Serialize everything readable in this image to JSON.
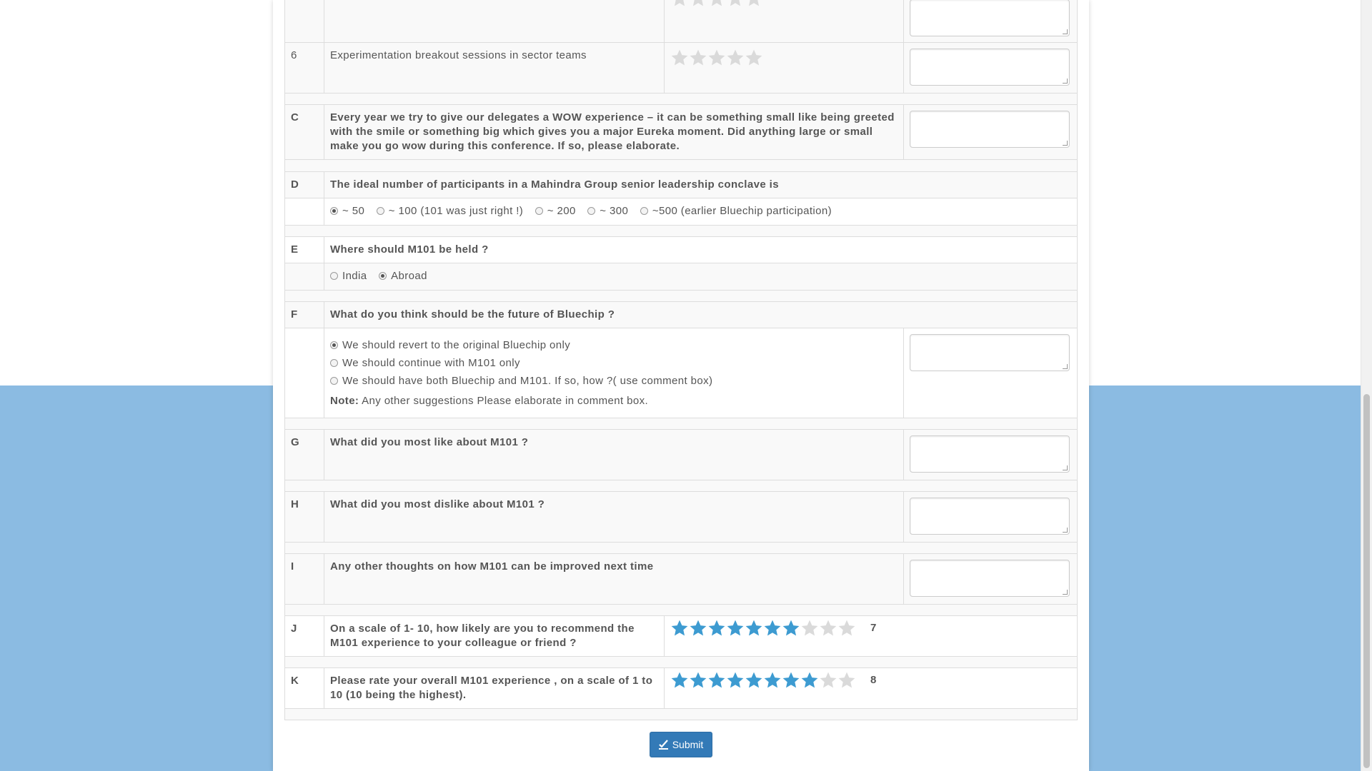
{
  "rows": {
    "r5": {
      "index": "",
      "text": ""
    },
    "r6": {
      "index": "6",
      "text": "Experimentation breakout sessions in sector teams"
    },
    "c": {
      "index": "C",
      "text": "Every year we try to give our delegates a WOW experience – it can be something small like being greeted with the smile or something big which gives you a major Eureka moment. Did anything large or small make you go wow during this conference. If so, please elaborate."
    },
    "d": {
      "index": "D",
      "text": "The ideal number of participants in a Mahindra Group senior leadership conclave is",
      "options": [
        "~ 50",
        "~ 100 (101 was just right !)",
        "~ 200",
        "~ 300",
        "~500 (earlier Bluechip participation)"
      ],
      "selected": 0
    },
    "e": {
      "index": "E",
      "text": "Where should M101 be held ?",
      "options": [
        "India",
        "Abroad"
      ],
      "selected": 1
    },
    "f": {
      "index": "F",
      "text": "What do you think should be the future of Bluechip ?",
      "options": [
        "We should revert to the original Bluechip only",
        "We should continue with M101 only",
        "We should have both Bluechip and M101. If so, how ?( use comment box)"
      ],
      "selected": 0,
      "note_label": "Note:",
      "note_text": "Any other suggestions Please elaborate in comment box."
    },
    "g": {
      "index": "G",
      "text": "What did you most like about M101 ?"
    },
    "h": {
      "index": "H",
      "text": "What did you most dislike about M101 ?"
    },
    "i": {
      "index": "I",
      "text": "Any other thoughts on how M101 can be improved next time"
    },
    "j": {
      "index": "J",
      "text": "On a scale of 1- 10, how likely are you to recommend the M101 experience to your colleague or friend ?",
      "score": "7",
      "max": 10
    },
    "k": {
      "index": "K",
      "text": "Please rate your overall M101 experience , on a scale of 1 to 10 (10 being the highest).",
      "score": "8",
      "max": 10
    }
  },
  "ratings": {
    "r5": 0,
    "r6": 0
  },
  "submit_label": "Submit",
  "colors": {
    "star_active": "#3d9bd1",
    "star_inactive": "#dadada",
    "page_bg": "#8bbbe2",
    "button": "#337ab7"
  }
}
